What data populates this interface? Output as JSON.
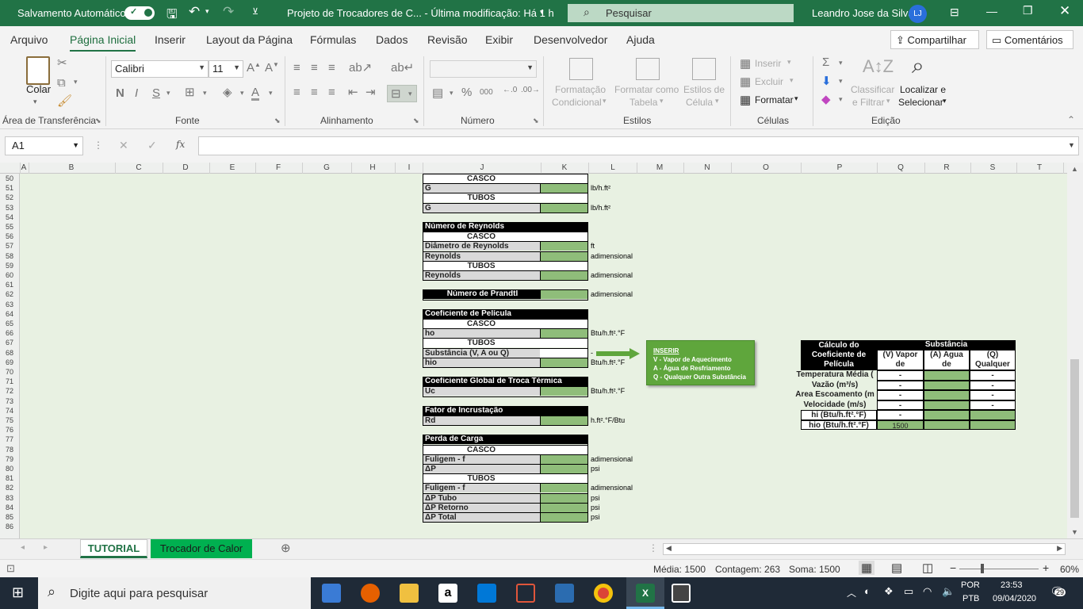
{
  "titlebar": {
    "autosave_label": "Salvamento Automático",
    "doc_title": "Projeto de Trocadores de C...  -  Última modificação: Há 1 h",
    "search_placeholder": "Pesquisar",
    "user_name": "Leandro Jose da Silva",
    "user_initials": "LJ"
  },
  "menu": {
    "tabs": [
      "Arquivo",
      "Página Inicial",
      "Inserir",
      "Layout da Página",
      "Fórmulas",
      "Dados",
      "Revisão",
      "Exibir",
      "Desenvolvedor",
      "Ajuda"
    ],
    "share": "Compartilhar",
    "comments": "Comentários"
  },
  "ribbon": {
    "clipboard": {
      "paste": "Colar",
      "group": "Área de Transferência"
    },
    "font": {
      "name": "Calibri",
      "size": "11",
      "bold": "N",
      "italic": "I",
      "underline": "S",
      "group": "Fonte"
    },
    "alignment": {
      "group": "Alinhamento"
    },
    "number": {
      "percent": "%",
      "thousands": "000",
      "group": "Número"
    },
    "styles": {
      "conditional": [
        "Formatação",
        "Condicional"
      ],
      "table": [
        "Formatar como",
        "Tabela"
      ],
      "cell": [
        "Estilos de",
        "Célula"
      ],
      "group": "Estilos"
    },
    "cells": {
      "insert": "Inserir",
      "delete": "Excluir",
      "format": "Formatar",
      "group": "Células"
    },
    "editing": {
      "sort": [
        "Classificar",
        "e Filtrar"
      ],
      "find": [
        "Localizar e",
        "Selecionar"
      ],
      "group": "Edição"
    }
  },
  "formula_bar": {
    "name_box": "A1",
    "fx": "fx",
    "content": ""
  },
  "columns": [
    "A",
    "B",
    "C",
    "D",
    "E",
    "F",
    "G",
    "H",
    "I",
    "J",
    "K",
    "L",
    "M",
    "N",
    "O",
    "P",
    "Q",
    "R",
    "S",
    "T"
  ],
  "rows": [
    "50",
    "51",
    "52",
    "53",
    "54",
    "55",
    "56",
    "57",
    "58",
    "59",
    "60",
    "61",
    "62",
    "63",
    "64",
    "65",
    "66",
    "67",
    "68",
    "69",
    "70",
    "71",
    "72",
    "73",
    "74",
    "75",
    "76",
    "77",
    "78",
    "79",
    "80",
    "81",
    "82",
    "83",
    "84",
    "85",
    "86"
  ],
  "sheet": {
    "casco": "CASCO",
    "tubos": "TUBOS",
    "g": "G",
    "unit_g": "lb/h.ft²",
    "reynolds_title": "Número de Reynolds",
    "reynolds_diam": "Diâmetro de Reynolds",
    "reynolds": "Reynolds",
    "unit_ft": "ft",
    "unit_adim": "adimensional",
    "prandtl": "Número de Prandtl",
    "pelicula_title": "Coeficiente de Película",
    "ho": "ho",
    "hio": "hio",
    "substancia": "Substância (V, A ou Q)",
    "dash": "-",
    "unit_btu": "Btu/h.ft².°F",
    "global_title": "Coeficiente Global de Troca Térmica",
    "uc": "Uc",
    "fator_title": "Fator de Incrustação",
    "rd": "Rd",
    "unit_rd": "h.ft².°F/Btu",
    "perda_title": "Perda de Carga",
    "fuligem": "Fuligem - f",
    "dp": "ΔP",
    "unit_psi": "psi",
    "dp_tubo": "ΔP Tubo",
    "dp_retorno": "ΔP Retorno",
    "dp_total": "ΔP Total"
  },
  "note": {
    "title": "INSERIR",
    "lines": [
      "V - Vapor de Aquecimento",
      "A - Água de Resfriamento",
      "Q - Qualquer Outra Substância"
    ]
  },
  "calc_table": {
    "title": [
      "Cálculo do",
      "Coeficiente de",
      "Película"
    ],
    "substancia": "Substância",
    "col_v": [
      "(V) Vapor",
      "de"
    ],
    "col_a": [
      "(A) Água",
      "de"
    ],
    "col_q": [
      "(Q)",
      "Qualquer"
    ],
    "rows": [
      {
        "label": "Temperatura Média (",
        "v": "-",
        "q": "-"
      },
      {
        "label": "Vazão (m³/s)",
        "v": "-",
        "q": "-"
      },
      {
        "label": "Área Escoamento (m",
        "v": "-",
        "q": "-"
      },
      {
        "label": "Velocidade (m/s)",
        "v": "-",
        "q": "-"
      },
      {
        "label": "hi (Btu/h.ft².°F)",
        "v": "-",
        "q": ""
      },
      {
        "label": "hio (Btu/h.ft².°F)",
        "v": "1500",
        "q": ""
      }
    ]
  },
  "sheet_tabs": {
    "tab1": "TUTORIAL",
    "tab2": "Trocador de Calor"
  },
  "status": {
    "media": "Média: 1500",
    "contagem": "Contagem: 263",
    "soma": "Soma: 1500",
    "zoom": "60%"
  },
  "taskbar": {
    "search": "Digite aqui para pesquisar",
    "lang1": "POR",
    "lang2": "PTB",
    "time": "23:53",
    "date": "09/04/2020",
    "notif": "29"
  },
  "colors": {
    "excel_green": "#217346",
    "cell_green": "#8fbd7a",
    "note_green": "#5fa63c",
    "sheet_bg": "#e8f1e2"
  }
}
